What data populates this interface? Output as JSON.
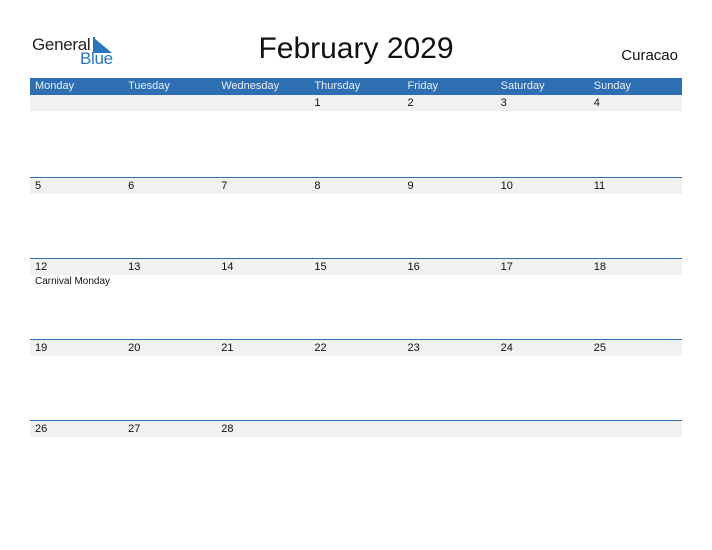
{
  "logo": {
    "line1": "General",
    "line2": "Blue"
  },
  "title": "February 2029",
  "country": "Curacao",
  "colors": {
    "accent": "#2e6fb3",
    "band": "#f1f1f1",
    "logo_blue": "#2a74c0"
  },
  "days_of_week": [
    "Monday",
    "Tuesday",
    "Wednesday",
    "Thursday",
    "Friday",
    "Saturday",
    "Sunday"
  ],
  "weeks": [
    {
      "days": [
        {
          "num": "",
          "event": ""
        },
        {
          "num": "",
          "event": ""
        },
        {
          "num": "",
          "event": ""
        },
        {
          "num": "1",
          "event": ""
        },
        {
          "num": "2",
          "event": ""
        },
        {
          "num": "3",
          "event": ""
        },
        {
          "num": "4",
          "event": ""
        }
      ]
    },
    {
      "days": [
        {
          "num": "5",
          "event": ""
        },
        {
          "num": "6",
          "event": ""
        },
        {
          "num": "7",
          "event": ""
        },
        {
          "num": "8",
          "event": ""
        },
        {
          "num": "9",
          "event": ""
        },
        {
          "num": "10",
          "event": ""
        },
        {
          "num": "11",
          "event": ""
        }
      ]
    },
    {
      "days": [
        {
          "num": "12",
          "event": "Carnival Monday"
        },
        {
          "num": "13",
          "event": ""
        },
        {
          "num": "14",
          "event": ""
        },
        {
          "num": "15",
          "event": ""
        },
        {
          "num": "16",
          "event": ""
        },
        {
          "num": "17",
          "event": ""
        },
        {
          "num": "18",
          "event": ""
        }
      ]
    },
    {
      "days": [
        {
          "num": "19",
          "event": ""
        },
        {
          "num": "20",
          "event": ""
        },
        {
          "num": "21",
          "event": ""
        },
        {
          "num": "22",
          "event": ""
        },
        {
          "num": "23",
          "event": ""
        },
        {
          "num": "24",
          "event": ""
        },
        {
          "num": "25",
          "event": ""
        }
      ]
    },
    {
      "days": [
        {
          "num": "26",
          "event": ""
        },
        {
          "num": "27",
          "event": ""
        },
        {
          "num": "28",
          "event": ""
        },
        {
          "num": "",
          "event": ""
        },
        {
          "num": "",
          "event": ""
        },
        {
          "num": "",
          "event": ""
        },
        {
          "num": "",
          "event": ""
        }
      ]
    }
  ]
}
